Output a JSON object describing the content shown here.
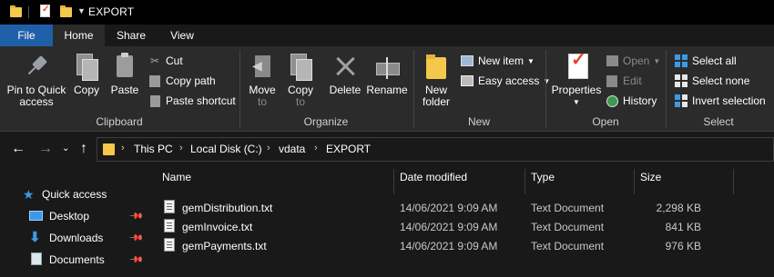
{
  "window": {
    "title": "EXPORT"
  },
  "ribbon_tabs": [
    "File",
    "Home",
    "Share",
    "View"
  ],
  "ribbon": {
    "clipboard": {
      "label": "Clipboard",
      "pin_line1": "Pin to Quick",
      "pin_line2": "access",
      "copy": "Copy",
      "paste": "Paste",
      "cut": "Cut",
      "copy_path": "Copy path",
      "paste_shortcut": "Paste shortcut"
    },
    "organize": {
      "label": "Organize",
      "move_to_line1": "Move",
      "move_to_line2": "to",
      "copy_to_line1": "Copy",
      "copy_to_line2": "to",
      "delete": "Delete",
      "rename": "Rename"
    },
    "new": {
      "label": "New",
      "new_folder_line1": "New",
      "new_folder_line2": "folder",
      "new_item": "New item",
      "easy_access": "Easy access"
    },
    "open": {
      "label": "Open",
      "properties": "Properties",
      "open": "Open",
      "edit": "Edit",
      "history": "History"
    },
    "select": {
      "label": "Select",
      "select_all": "Select all",
      "select_none": "Select none",
      "invert_selection": "Invert selection"
    }
  },
  "address_bar": {
    "path": [
      "This PC",
      "Local Disk (C:)",
      "vdata",
      "EXPORT"
    ]
  },
  "sidebar": {
    "items": [
      {
        "label": "Quick access",
        "icon": "star-icon"
      },
      {
        "label": "Desktop",
        "icon": "desktop-icon",
        "pinned": true
      },
      {
        "label": "Downloads",
        "icon": "download-icon",
        "pinned": true
      },
      {
        "label": "Documents",
        "icon": "documents-icon",
        "pinned": true
      }
    ]
  },
  "file_list": {
    "columns": [
      "Name",
      "Date modified",
      "Type",
      "Size"
    ],
    "rows": [
      {
        "name": "gemDistribution.txt",
        "date": "14/06/2021 9:09 AM",
        "type": "Text Document",
        "size": "2,298 KB"
      },
      {
        "name": "gemInvoice.txt",
        "date": "14/06/2021 9:09 AM",
        "type": "Text Document",
        "size": "841 KB"
      },
      {
        "name": "gemPayments.txt",
        "date": "14/06/2021 9:09 AM",
        "type": "Text Document",
        "size": "976 KB"
      }
    ]
  },
  "colors": {
    "file_tab": "#1f5fa8",
    "background": "#191919",
    "ribbon": "#2b2b2b",
    "folder": "#f3c84b",
    "accent_blue": "#3b9ae6"
  }
}
